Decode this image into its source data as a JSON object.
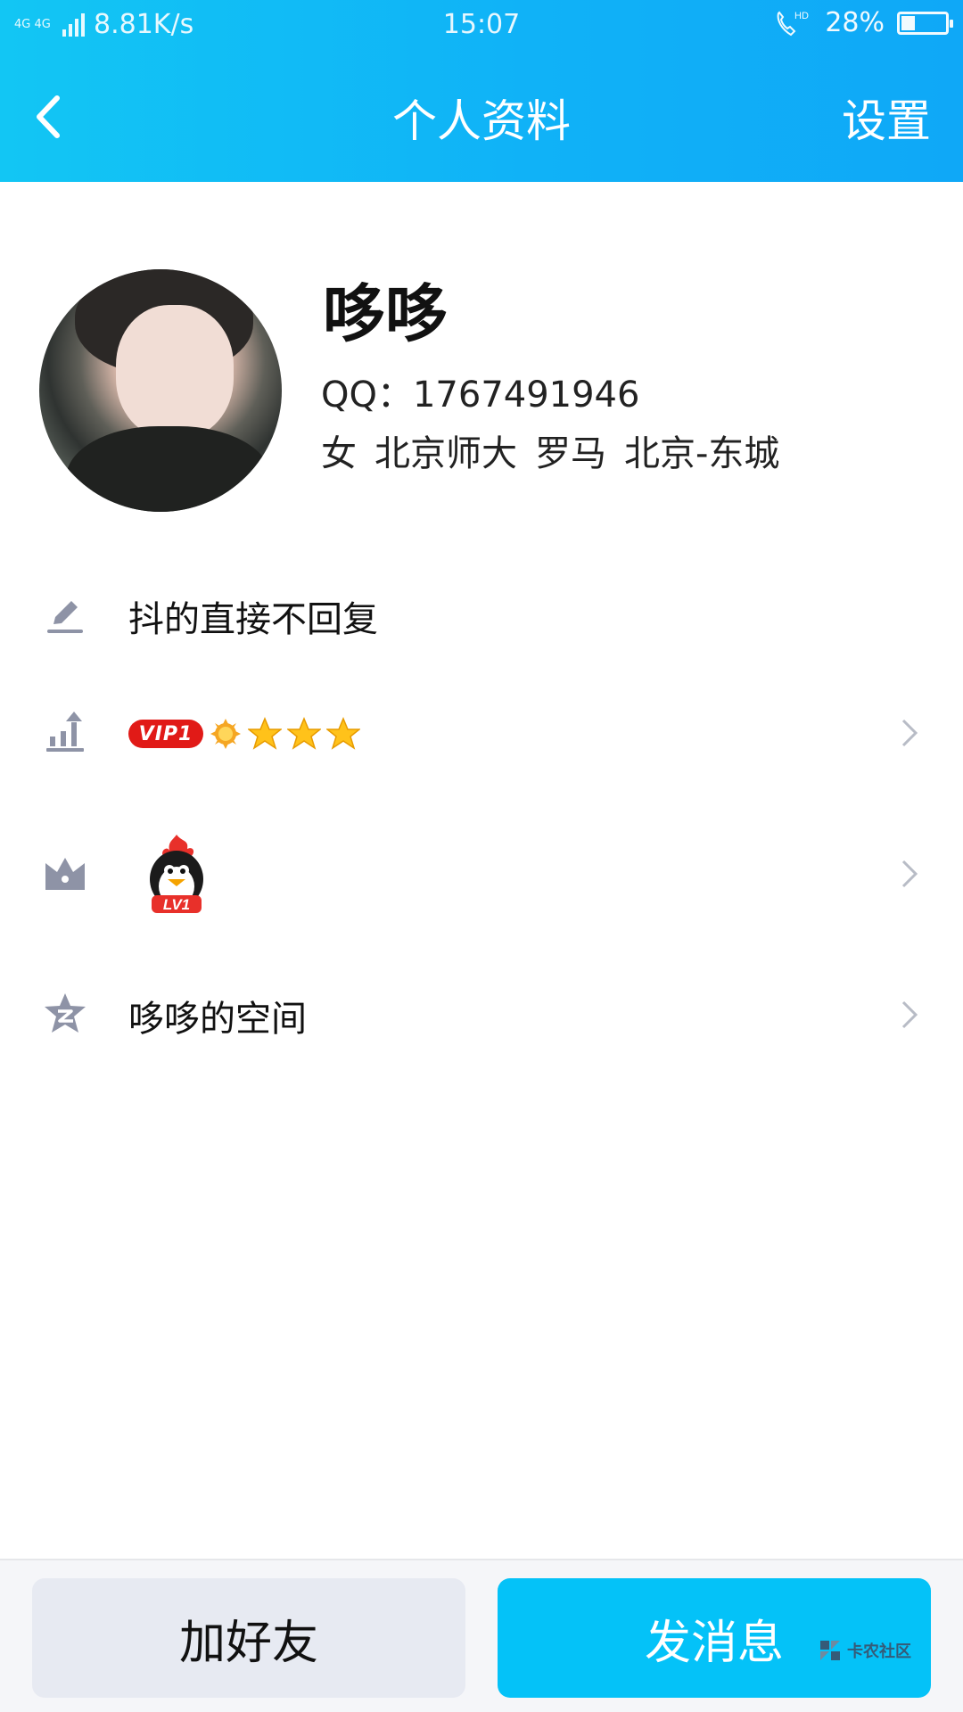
{
  "status_bar": {
    "network": "4G 4G",
    "speed": "8.81K/s",
    "time": "15:07",
    "call_indicator": "HD",
    "battery_percent": "28%",
    "battery_level": 0.28
  },
  "nav": {
    "back_icon": "chevron-left-icon",
    "title": "个人资料",
    "settings_label": "设置"
  },
  "profile": {
    "name": "哆哆",
    "qq": "QQ：1767491946",
    "gender": "女",
    "school": "北京师大",
    "constellation": "罗马",
    "location": "北京-东城"
  },
  "rows": {
    "signature": {
      "icon": "pencil-icon",
      "text": "抖的直接不回复"
    },
    "vip": {
      "icon": "level-up-chart-icon",
      "badge": "VIP1",
      "badge_color": "#e11a17",
      "level_icons": [
        "sun-icon",
        "star-icon",
        "star-icon",
        "star-icon"
      ]
    },
    "pet": {
      "icon": "crown-icon",
      "penguin_level": "LV1"
    },
    "space": {
      "icon": "qzone-star-icon",
      "text": "哆哆的空间"
    }
  },
  "footer": {
    "add_friend_label": "加好友",
    "send_message_label": "发消息",
    "watermark_text": "卡农社区"
  },
  "colors": {
    "header_start": "#12c6f4",
    "header_end": "#0fa8f7",
    "primary_button": "#04c2f8",
    "secondary_button": "#e7eaf2"
  }
}
